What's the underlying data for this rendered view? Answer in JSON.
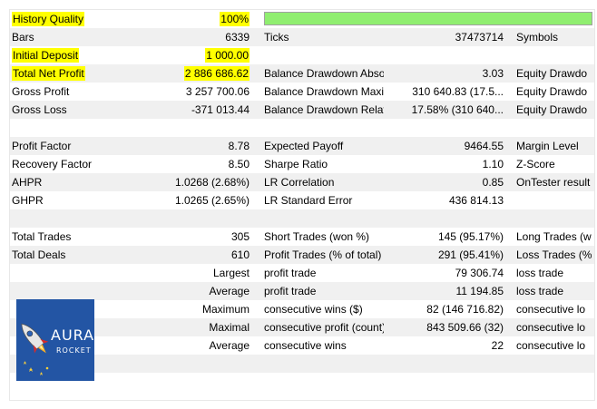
{
  "quality": {
    "label": "History Quality",
    "value": "100%",
    "fill_percent": 100
  },
  "bars": {
    "label": "Bars",
    "value": "6339",
    "ticks_label": "Ticks",
    "ticks_value": "37473714",
    "symbols_label": "Symbols"
  },
  "deposit": {
    "label": "Initial Deposit",
    "value": "1 000.00"
  },
  "net": {
    "label": "Total Net Profit",
    "value": "2 886 686.62",
    "c3": "Balance Drawdown Absol...",
    "c4": "3.03",
    "c5": "Equity Drawdo"
  },
  "gross_profit": {
    "label": "Gross Profit",
    "value": "3 257 700.06",
    "c3": "Balance Drawdown Maxi...",
    "c4": "310 640.83 (17.5...",
    "c5": "Equity Drawdo"
  },
  "gross_loss": {
    "label": "Gross Loss",
    "value": "-371 013.44",
    "c3": "Balance Drawdown Relati...",
    "c4": "17.58% (310 640...",
    "c5": "Equity Drawdo"
  },
  "pf": {
    "label": "Profit Factor",
    "value": "8.78",
    "c3": "Expected Payoff",
    "c4": "9464.55",
    "c5": "Margin Level"
  },
  "rf": {
    "label": "Recovery Factor",
    "value": "8.50",
    "c3": "Sharpe Ratio",
    "c4": "1.10",
    "c5": "Z-Score"
  },
  "ahpr": {
    "label": "AHPR",
    "value": "1.0268 (2.68%)",
    "c3": "LR Correlation",
    "c4": "0.85",
    "c5": "OnTester result"
  },
  "ghpr": {
    "label": "GHPR",
    "value": "1.0265 (2.65%)",
    "c3": "LR Standard Error",
    "c4": "436 814.13",
    "c5": ""
  },
  "trades": {
    "label": "Total Trades",
    "value": "305",
    "c3": "Short Trades (won %)",
    "c4": "145 (95.17%)",
    "c5": "Long Trades (w"
  },
  "deals": {
    "label": "Total Deals",
    "value": "610",
    "c3": "Profit Trades (% of total)",
    "c4": "291 (95.41%)",
    "c5": "Loss Trades (%"
  },
  "largest": {
    "label": "Largest",
    "c3": "profit trade",
    "c4": "79 306.74",
    "c5": "loss trade"
  },
  "average": {
    "label": "Average",
    "c3": "profit trade",
    "c4": "11 194.85",
    "c5": "loss trade"
  },
  "maximum": {
    "label": "Maximum",
    "c3": "consecutive wins ($)",
    "c4": "82 (146 716.82)",
    "c5": "consecutive lo"
  },
  "maximal": {
    "label": "Maximal",
    "c3": "consecutive profit (count)",
    "c4": "843 509.66 (32)",
    "c5": "consecutive lo"
  },
  "average2": {
    "label": "Average",
    "c3": "consecutive wins",
    "c4": "22",
    "c5": "consecutive lo"
  },
  "logo": {
    "line1": "AURA",
    "line2": "ROCKET"
  },
  "colors": {
    "highlight": "#ffff00",
    "bar_fill": "#90ee70",
    "row_alt": "#f0f0f0",
    "logo_bg": "#1f4e9a"
  }
}
